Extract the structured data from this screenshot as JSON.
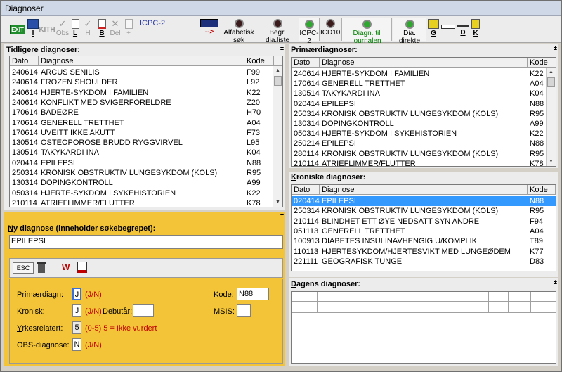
{
  "window": {
    "title": "Diagnoser"
  },
  "toolbar": {
    "exit": "EXIT",
    "i": "I",
    "kith": "KITH",
    "obs": "Obs",
    "l": "L",
    "h": "H",
    "b": "B",
    "del": "Del",
    "plus": "+",
    "icpc2_title": "ICPC-2",
    "arrow": "-->",
    "alfabetisk_sok": "Alfabetisk søk",
    "begr_dia_liste": "Begr. dia.liste",
    "icpc2": "ICPC-2",
    "icd10": "ICD10",
    "diagn_til_journalen": "Diagn. til journalen",
    "dia_direkte": "Dia. direkte",
    "g": "G",
    "d": "D",
    "k": "K"
  },
  "tidligere": {
    "title_u": "T",
    "title_rest": "idligere diagnoser:",
    "col_dato": "Dato",
    "col_diagnose": "Diagnose",
    "col_kode": "Kode",
    "rows": [
      {
        "dato": "240614",
        "diagnose": "ARCUS SENILIS",
        "kode": "F99"
      },
      {
        "dato": "240614",
        "diagnose": "FROZEN SHOULDER",
        "kode": "L92"
      },
      {
        "dato": "240614",
        "diagnose": "HJERTE-SYKDOM I FAMILIEN",
        "kode": "K22"
      },
      {
        "dato": "240614",
        "diagnose": "KONFLIKT MED SVIGERFORELDRE",
        "kode": "Z20"
      },
      {
        "dato": "170614",
        "diagnose": "BADEØRE",
        "kode": "H70"
      },
      {
        "dato": "170614",
        "diagnose": "GENERELL TRETTHET",
        "kode": "A04"
      },
      {
        "dato": "170614",
        "diagnose": "UVEITT IKKE AKUTT",
        "kode": "F73"
      },
      {
        "dato": "130514",
        "diagnose": "OSTEOPOROSE BRUDD RYGGVIRVEL",
        "kode": "L95"
      },
      {
        "dato": "130514",
        "diagnose": "TAKYKARDI INA",
        "kode": "K04"
      },
      {
        "dato": "020414",
        "diagnose": "EPILEPSI",
        "kode": "N88"
      },
      {
        "dato": "250314",
        "diagnose": "KRONISK OBSTRUKTIV LUNGESYKDOM (KOLS)",
        "kode": "R95"
      },
      {
        "dato": "130314",
        "diagnose": "DOPINGKONTROLL",
        "kode": "A99"
      },
      {
        "dato": "050314",
        "diagnose": "HJERTE-SYKDOM I SYKEHISTORIEN",
        "kode": "K22"
      },
      {
        "dato": "210114",
        "diagnose": "ATRIEFLIMMER/FLUTTER",
        "kode": "K78"
      }
    ]
  },
  "primaer": {
    "title_u": "P",
    "title_rest": "rimærdiagnoser:",
    "col_dato": "Dato",
    "col_diagnose": "Diagnose",
    "col_kode": "Kode",
    "rows": [
      {
        "dato": "240614",
        "diagnose": "HJERTE-SYKDOM I FAMILIEN",
        "kode": "K22"
      },
      {
        "dato": "170614",
        "diagnose": "GENERELL TRETTHET",
        "kode": "A04"
      },
      {
        "dato": "130514",
        "diagnose": "TAKYKARDI INA",
        "kode": "K04"
      },
      {
        "dato": "020414",
        "diagnose": "EPILEPSI",
        "kode": "N88"
      },
      {
        "dato": "250314",
        "diagnose": "KRONISK OBSTRUKTIV LUNGESYKDOM (KOLS)",
        "kode": "R95"
      },
      {
        "dato": "130314",
        "diagnose": "DOPINGKONTROLL",
        "kode": "A99"
      },
      {
        "dato": "050314",
        "diagnose": "HJERTE-SYKDOM I SYKEHISTORIEN",
        "kode": "K22"
      },
      {
        "dato": "250214",
        "diagnose": "EPILEPSI",
        "kode": "N88"
      },
      {
        "dato": "280114",
        "diagnose": "KRONISK OBSTRUKTIV LUNGESYKDOM (KOLS)",
        "kode": "R95"
      },
      {
        "dato": "210114",
        "diagnose": "ATRIEFLIMMER/FLUTTER",
        "kode": "K78"
      }
    ]
  },
  "kroniske": {
    "title_u": "K",
    "title_rest": "roniske diagnoser:",
    "col_dato": "Dato",
    "col_diagnose": "Diagnose",
    "col_kode": "Kode",
    "rows": [
      {
        "dato": "020414",
        "diagnose": "EPILEPSI",
        "kode": "N88"
      },
      {
        "dato": "250314",
        "diagnose": "KRONISK OBSTRUKTIV LUNGESYKDOM (KOLS)",
        "kode": "R95"
      },
      {
        "dato": "210114",
        "diagnose": "BLINDHET ETT ØYE NEDSATT SYN ANDRE",
        "kode": "F94"
      },
      {
        "dato": "051113",
        "diagnose": "GENERELL TRETTHET",
        "kode": "A04"
      },
      {
        "dato": "100913",
        "diagnose": "DIABETES INSULINAVHENGIG U/KOMPLIK",
        "kode": "T89"
      },
      {
        "dato": "110113",
        "diagnose": "HJERTESYKDOM/HJERTESVIKT MED LUNGEØDEM",
        "kode": "K77"
      },
      {
        "dato": "221111",
        "diagnose": "GEOGRAFISK TUNGE",
        "kode": "D83"
      }
    ]
  },
  "dagens": {
    "title_u": "D",
    "title_rest": "agens diagnoser:"
  },
  "ny": {
    "title_u": "N",
    "title_rest": "y diagnose (inneholder søkebegrepet):",
    "search_value": "EPILEPSI",
    "esc": "ESC",
    "w": "W",
    "primaer_label": "Primærdiagn:",
    "primaer_value": "J",
    "jn1": "(J/N)",
    "kronisk_label": "Kronisk:",
    "kronisk_value": "J",
    "jn2": "(J/N)",
    "debut_label": "Debutår:",
    "debut_value": "",
    "yrkes_label_u": "Y",
    "yrkes_label_rest": "rkesrelatert:",
    "yrkes_value": "5",
    "yrkes_hint": "(0-5)  5 = Ikke vurdert",
    "obs_label": "OBS-diagnose:",
    "obs_value": "N",
    "jn3": "(J/N)",
    "kode_label": "Kode:",
    "kode_value": "N88",
    "msis_label": "MSIS:",
    "msis_value": ""
  }
}
